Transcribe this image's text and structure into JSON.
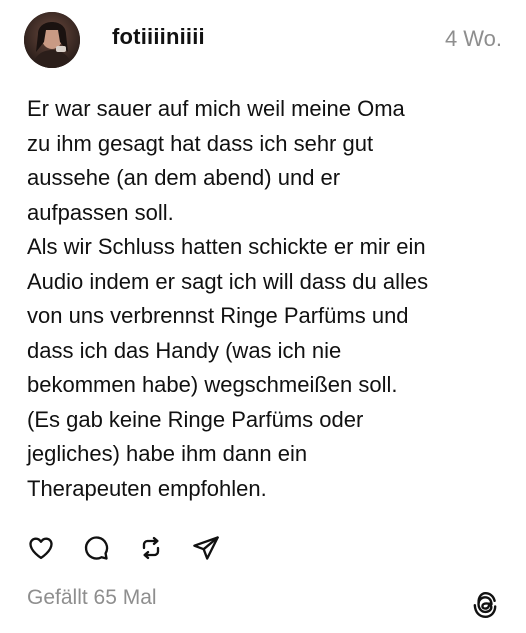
{
  "post": {
    "username": "fotiiiiniiii",
    "timestamp": "4 Wo.",
    "text_lines": [
      "Er war sauer auf mich weil meine Oma",
      "zu ihm gesagt hat dass ich sehr gut",
      "aussehe (an dem abend) und er",
      "aufpassen soll.",
      "Als wir Schluss hatten schickte er mir ein",
      "Audio indem er sagt ich will dass du alles",
      "von uns verbrennst Ringe Parfüms und",
      "dass ich das Handy (was ich nie",
      "bekommen habe) wegschmeißen soll.",
      "(Es gab keine Ringe Parfüms oder",
      "jegliches) habe ihm dann ein",
      "Therapeuten empfohlen."
    ],
    "likes": "Gefällt 65 Mal"
  },
  "icons": {
    "avatar": "profile-photo",
    "like": "heart-icon",
    "comment": "speech-bubble-icon",
    "repost": "repost-arrows-icon",
    "share": "paper-plane-icon",
    "brand": "threads-logo-icon"
  },
  "colors": {
    "text": "#111111",
    "muted": "#8e8e8e",
    "background": "#ffffff"
  }
}
